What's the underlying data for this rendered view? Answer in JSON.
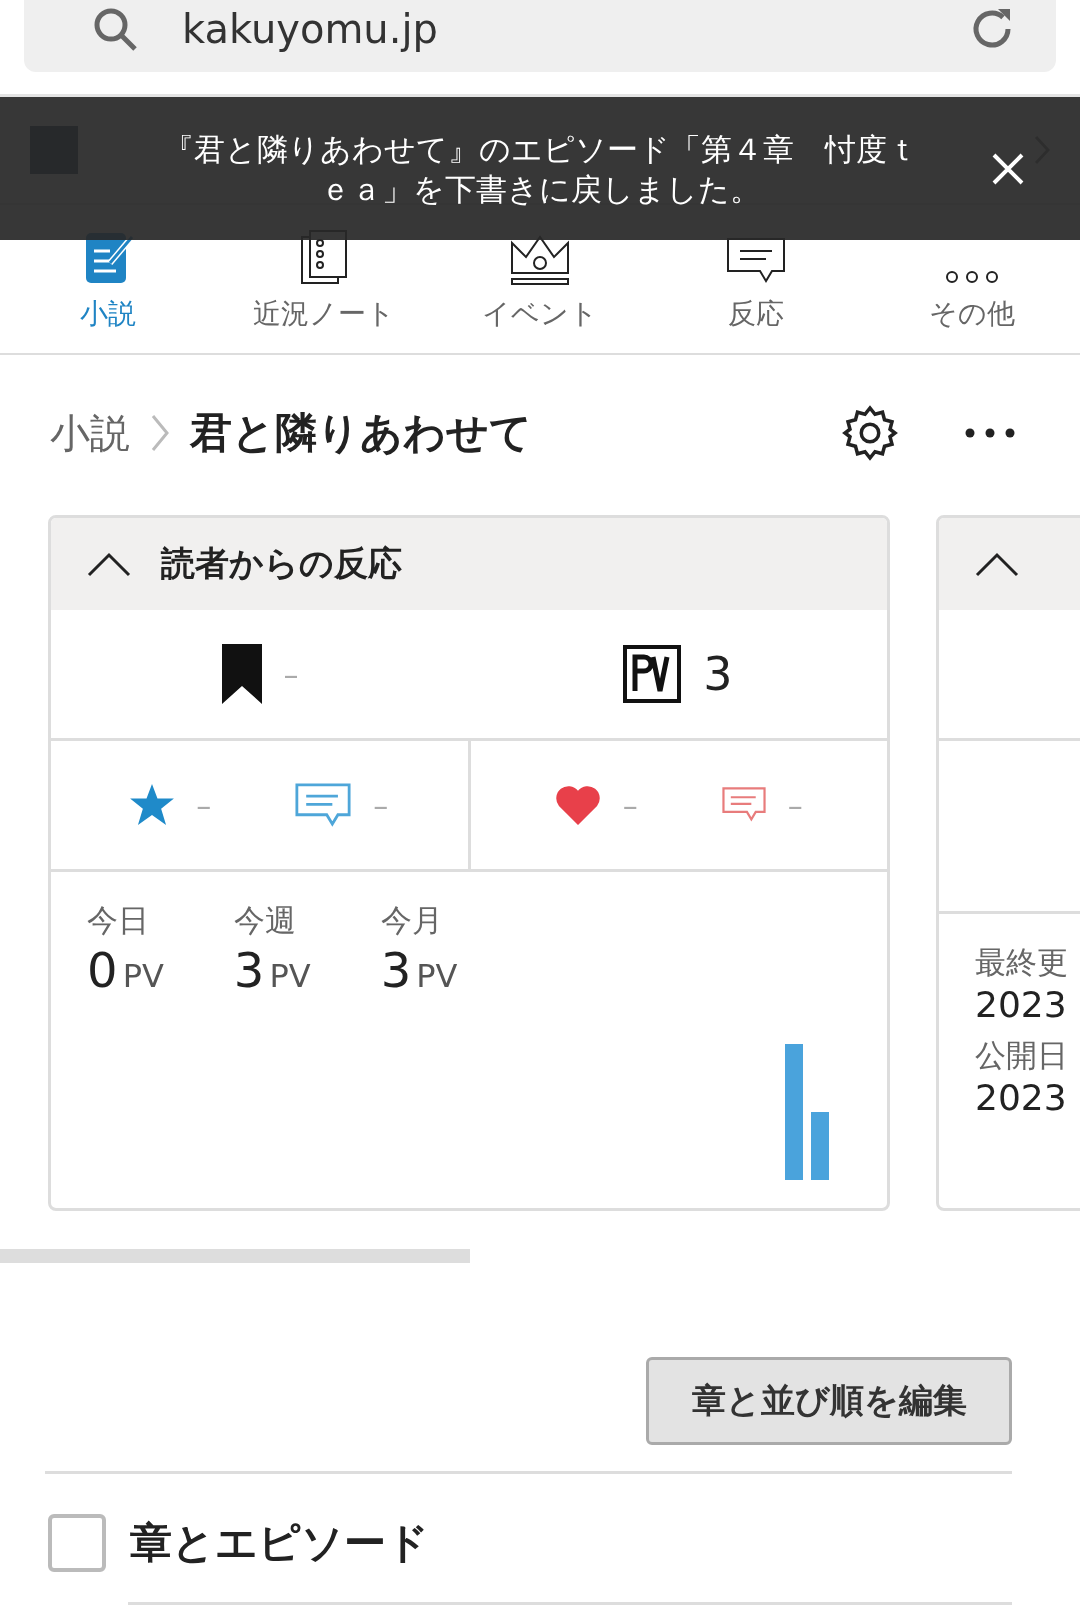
{
  "browser": {
    "url": "kakuyomu.jp"
  },
  "toast": {
    "message": "『君と隣りあわせて』のエピソード「第４章　忖度ｔｅａ」を下書きに戻しました。"
  },
  "nav": [
    {
      "label": "小説",
      "kind": "novel",
      "selected": true
    },
    {
      "label": "近況ノート",
      "kind": "notes",
      "selected": false
    },
    {
      "label": "イベント",
      "kind": "event",
      "selected": false
    },
    {
      "label": "反応",
      "kind": "reaction",
      "selected": false
    },
    {
      "label": "その他",
      "kind": "more",
      "selected": false
    }
  ],
  "breadcrumb": {
    "parent": "小説",
    "current": "君と隣りあわせて"
  },
  "reaction_card": {
    "title": "読者からの反応",
    "expanded": true,
    "follows": "–",
    "pv": "3",
    "star_count": "–",
    "reviews": "–",
    "hearts": "–",
    "comments": "–",
    "periods": [
      {
        "label": "今日",
        "value": "0",
        "unit": "PV"
      },
      {
        "label": "今週",
        "value": "3",
        "unit": "PV"
      },
      {
        "label": "今月",
        "value": "3",
        "unit": "PV"
      }
    ]
  },
  "info_card": {
    "expanded": true,
    "fields": [
      {
        "label": "最終更",
        "value": "2023"
      },
      {
        "label": "公開日",
        "value": "2023"
      }
    ]
  },
  "edit_button": "章と並び順を編集",
  "episodes": {
    "label": "章とエピソード",
    "checked": false
  }
}
